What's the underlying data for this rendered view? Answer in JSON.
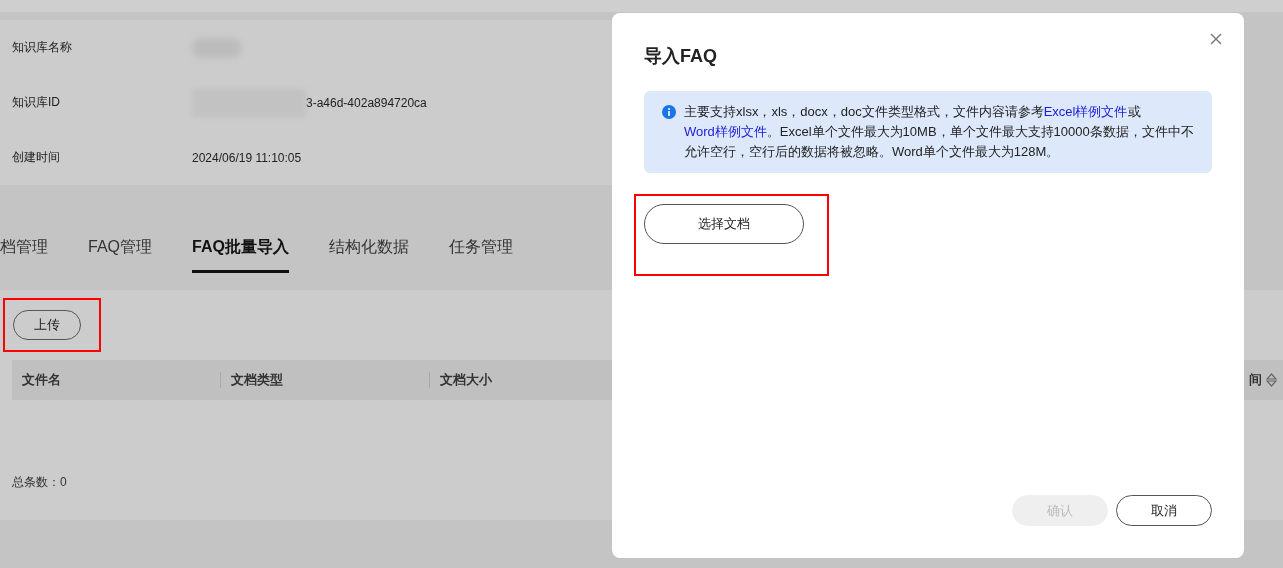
{
  "info": [
    {
      "label": "知识库名称",
      "redacted": true
    },
    {
      "label": "知识库ID",
      "value": "3-a46d-402a894720ca",
      "redacted": true
    },
    {
      "label": "创建时间",
      "value": "2024/06/19 11:10:05",
      "redacted": false
    }
  ],
  "tabs": [
    {
      "label": "档管理",
      "selected": false
    },
    {
      "label": "FAQ管理",
      "selected": false
    },
    {
      "label": "FAQ批量导入",
      "selected": true
    },
    {
      "label": "结构化数据",
      "selected": false
    },
    {
      "label": "任务管理",
      "selected": false
    }
  ],
  "upload_button": {
    "label": "上传",
    "highlighted": true
  },
  "table": {
    "columns": [
      "文件名",
      "文档类型",
      "文档大小"
    ],
    "column_4": "间"
  },
  "total": "总条数：0",
  "dialog": {
    "title": "导入FAQ",
    "notice": [
      {
        "kind": "text",
        "text": "主要支持xlsx，xls，docx，doc文件类型格式，文件内容请参考"
      },
      {
        "kind": "link",
        "text": "Excel样例文件"
      },
      {
        "kind": "text",
        "text": "或"
      },
      {
        "kind": "link",
        "text": "Word样例文件"
      },
      {
        "kind": "text",
        "text": "。Excel单个文件最大为10MB，单个文件最大支持10000条数据，文件中不允许空行，空行后的数据将被忽略。Word单个文件最大为128M。"
      }
    ],
    "select_button": {
      "label": "选择文档",
      "highlighted": true
    },
    "buttons": [
      {
        "label": "确认",
        "disabled": true
      },
      {
        "label": "取消",
        "disabled": false
      }
    ]
  }
}
